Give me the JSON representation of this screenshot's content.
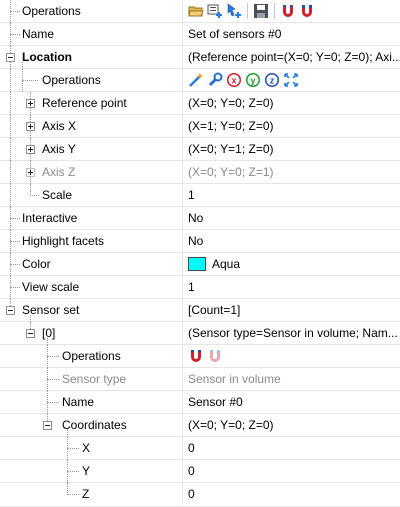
{
  "rows": [
    {
      "label": "Operations",
      "value": ""
    },
    {
      "label": "Name",
      "value": "Set of sensors #0"
    },
    {
      "label": "Location",
      "value": "(Reference point=(X=0; Y=0; Z=0); Axi..."
    },
    {
      "label": "Operations",
      "value": ""
    },
    {
      "label": "Reference point",
      "value": "(X=0; Y=0; Z=0)"
    },
    {
      "label": "Axis X",
      "value": "(X=1; Y=0; Z=0)"
    },
    {
      "label": "Axis Y",
      "value": "(X=0; Y=1; Z=0)"
    },
    {
      "label": "Axis Z",
      "value": "(X=0; Y=0; Z=1)"
    },
    {
      "label": "Scale",
      "value": "1"
    },
    {
      "label": "Interactive",
      "value": "No"
    },
    {
      "label": "Highlight facets",
      "value": "No"
    },
    {
      "label": "Color",
      "value": "Aqua"
    },
    {
      "label": "View scale",
      "value": "1"
    },
    {
      "label": "Sensor set",
      "value": "[Count=1]"
    },
    {
      "label": "[0]",
      "value": "(Sensor type=Sensor in volume; Nam..."
    },
    {
      "label": "Operations",
      "value": ""
    },
    {
      "label": "Sensor type",
      "value": "Sensor in volume"
    },
    {
      "label": "Name",
      "value": "Sensor #0"
    },
    {
      "label": "Coordinates",
      "value": "(X=0; Y=0; Z=0)"
    },
    {
      "label": "X",
      "value": "0"
    },
    {
      "label": "Y",
      "value": "0"
    },
    {
      "label": "Z",
      "value": "0"
    }
  ],
  "colors": {
    "swatch": "#00ffff",
    "magnet_red": "#d0202a",
    "magnet_blue": "#1f4fb0"
  },
  "icons": {
    "row0": [
      "open-folder-icon",
      "add-list-icon",
      "add-pointer-icon",
      "save-disk-icon",
      "magnet-red-icon",
      "magnet-blue-icon"
    ],
    "row3": [
      "magic-wand-icon",
      "wrench-icon",
      "rotate-x-icon",
      "rotate-y-icon",
      "rotate-z-icon",
      "fit-arrows-icon"
    ],
    "row15": [
      "magnet-red-icon",
      "magnet-faded-icon"
    ]
  }
}
